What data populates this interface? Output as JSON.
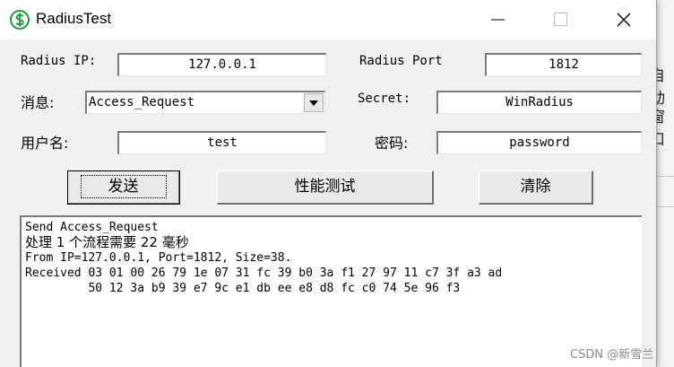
{
  "window": {
    "title": "RadiusTest"
  },
  "form": {
    "radius_ip_label": "Radius IP:",
    "radius_ip_value": "127.0.0.1",
    "radius_port_label": "Radius Port",
    "radius_port_value": "1812",
    "message_label": "消息:",
    "message_value": "Access_Request",
    "secret_label": "Secret:",
    "secret_value": "WinRadius",
    "username_label": "用户名:",
    "username_value": "test",
    "password_label": "密码:",
    "password_value": "password"
  },
  "buttons": {
    "send": "发送",
    "perf_test": "性能测试",
    "clear": "清除"
  },
  "output": {
    "lines": [
      "Send Access_Request",
      "处理 1 个流程需要 22 毫秒",
      "From IP=127.0.0.1, Port=1812, Size=38.",
      "Received 03 01 00 26 79 1e 07 31 fc 39 b0 3a f1 27 97 11 c7 3f a3 ad",
      "         50 12 3a b9 39 e7 9c e1 db ee e8 d8 fc c0 74 5e 96 f3"
    ]
  },
  "background_app": {
    "text_1": "自动",
    "text_2": "窗口"
  },
  "watermark": "CSDN @新雪兰",
  "colors": {
    "icon_green": "#1f9a3a"
  },
  "icons": {
    "app": "dollar-icon",
    "minimize": "minimize-icon",
    "maximize": "maximize-icon",
    "close": "close-icon",
    "dropdown": "dropdown-arrow-icon"
  }
}
